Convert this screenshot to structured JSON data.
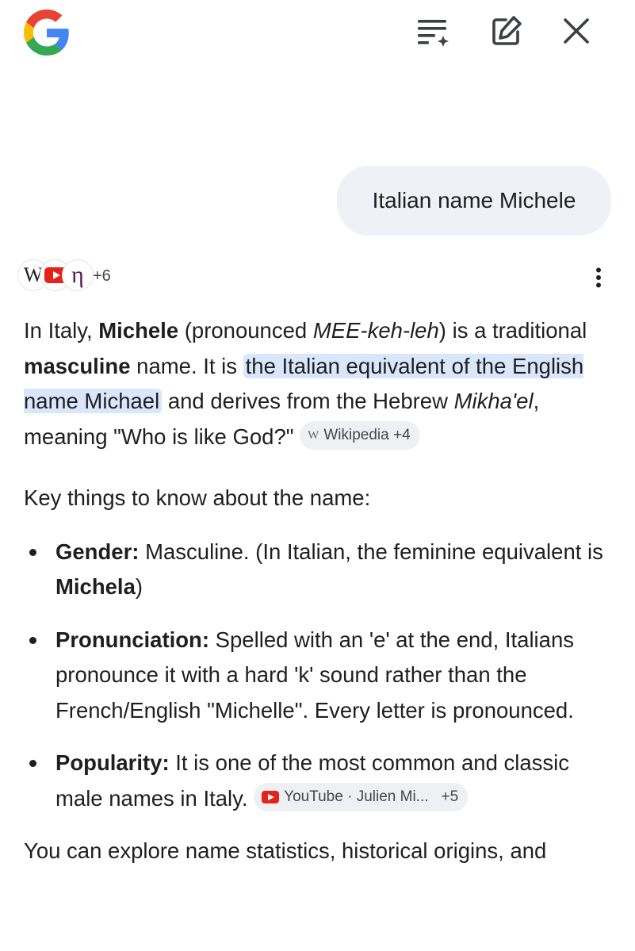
{
  "header": {
    "logo_icon": "google-g-logo",
    "icons": [
      "history-list-icon",
      "new-chat-edit-icon",
      "close-icon"
    ]
  },
  "query": "Italian name Michele",
  "sources": {
    "icons": [
      "wikipedia-icon",
      "youtube-icon",
      "nameberry-icon"
    ],
    "more_count": "+6"
  },
  "answer": {
    "p1": {
      "t1": "In Italy, ",
      "b1": "Michele",
      "t2": " (pronounced ",
      "i1": "MEE-keh-leh",
      "t3": ") is a traditional ",
      "b2": "masculine",
      "t4": " name. It is ",
      "hl": "the Italian equivalent of the English name Michael",
      "t5": " and derives from the Hebrew ",
      "i2": "Mikha'el",
      "t6": ", meaning \"Who is like God?\" ",
      "chip_label": "Wikipedia +4"
    },
    "key_heading": "Key things to know about the name:",
    "bullets": [
      {
        "label": "Gender:",
        "text": " Masculine. (In Italian, the feminine equivalent is ",
        "bold_tail": "Michela",
        "tail": ")"
      },
      {
        "label": "Pronunciation:",
        "text": " Spelled with an 'e' at the end, Italians pronounce it with a hard 'k' sound rather than the French/English \"Michelle\". Every letter is pronounced."
      },
      {
        "label": "Popularity:",
        "text": " It is one of the most common and classic male names in Italy. ",
        "chip_label": "YouTube · Julien Mi...",
        "chip_count": "+5"
      }
    ],
    "closing": "You can explore name statistics, historical origins, and"
  },
  "colors": {
    "highlight": "#d9e6fb",
    "chip_bg": "#eef0f4",
    "bubble_bg": "#eef1f6",
    "text": "#1f1f1f"
  }
}
